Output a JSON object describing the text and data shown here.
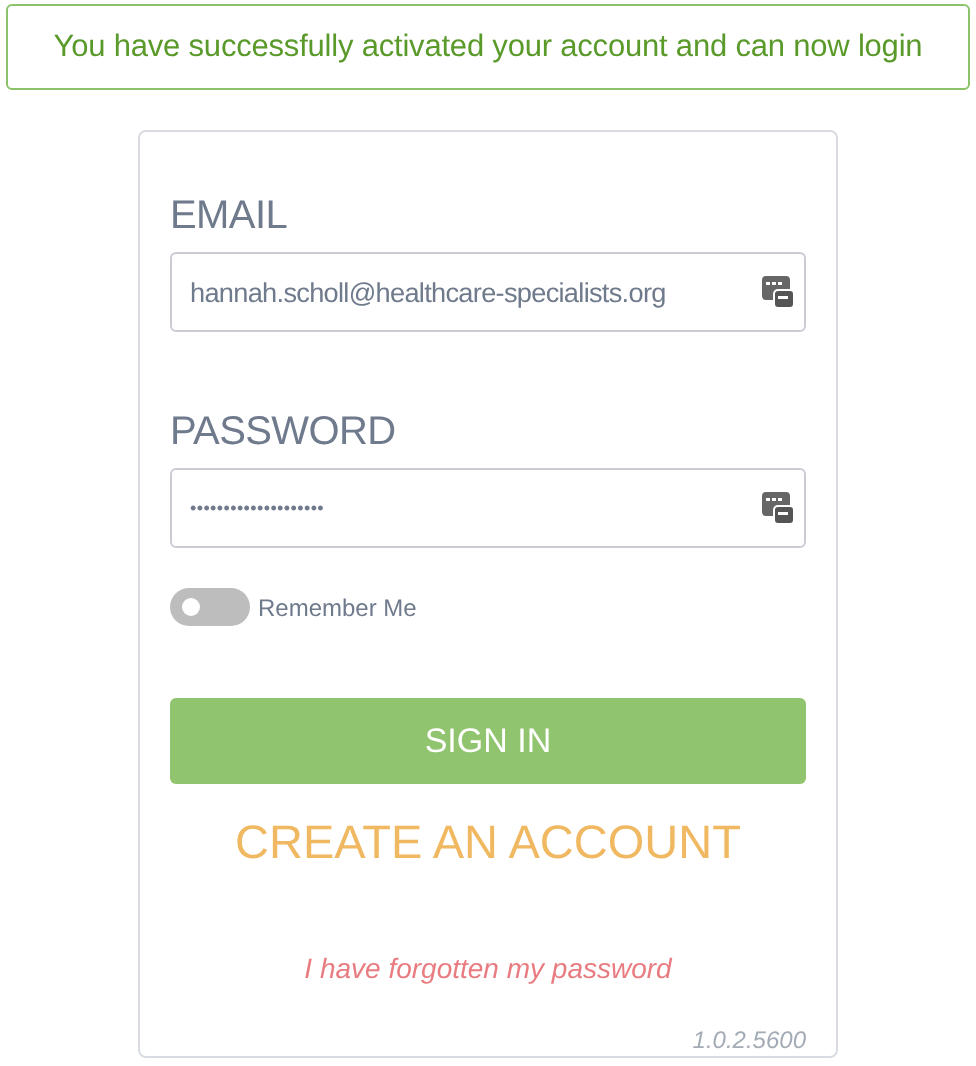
{
  "alert": {
    "message": "You have successfully activated your account and can now login"
  },
  "form": {
    "email": {
      "label": "EMAIL",
      "value": "hannah.scholl@healthcare-specialists.org"
    },
    "password": {
      "label": "PASSWORD",
      "value": "••••••••••••••••••••"
    },
    "remember": {
      "label": "Remember Me",
      "on": false
    },
    "sign_in": "SIGN IN",
    "create_account": "CREATE AN ACCOUNT",
    "forgot_password": "I have forgotten my password",
    "version": "1.0.2.5600"
  }
}
